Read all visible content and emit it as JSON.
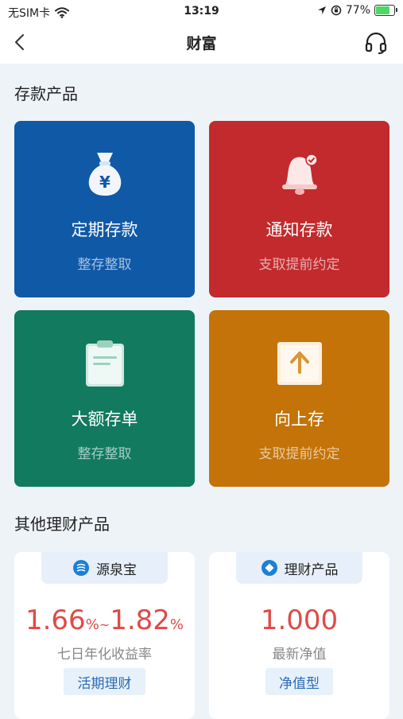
{
  "status_bar": {
    "carrier": "无SIM卡",
    "time": "13:19",
    "battery": "77%"
  },
  "navbar": {
    "title": "财富"
  },
  "deposit_section": {
    "title": "存款产品",
    "tiles": [
      {
        "name": "定期存款",
        "sub": "整存整取",
        "icon": "money-bag-icon",
        "color": "#1059a7"
      },
      {
        "name": "通知存款",
        "sub": "支取提前约定",
        "icon": "bell-icon",
        "color": "#c32a2d"
      },
      {
        "name": "大额存单",
        "sub": "整存整取",
        "icon": "clipboard-icon",
        "color": "#117a5f"
      },
      {
        "name": "向上存",
        "sub": "支取提前约定",
        "icon": "arrow-up-icon",
        "color": "#c37307"
      }
    ]
  },
  "other_section": {
    "title": "其他理财产品",
    "cards": [
      {
        "tag": "源泉宝",
        "value_low": "1.66",
        "value_high": "1.82",
        "pct": "%",
        "sep": "~",
        "caption": "七日年化收益率",
        "pill": "活期理财"
      },
      {
        "tag": "理财产品",
        "value": "1.000",
        "caption": "最新净值",
        "pill": "净值型"
      }
    ]
  }
}
